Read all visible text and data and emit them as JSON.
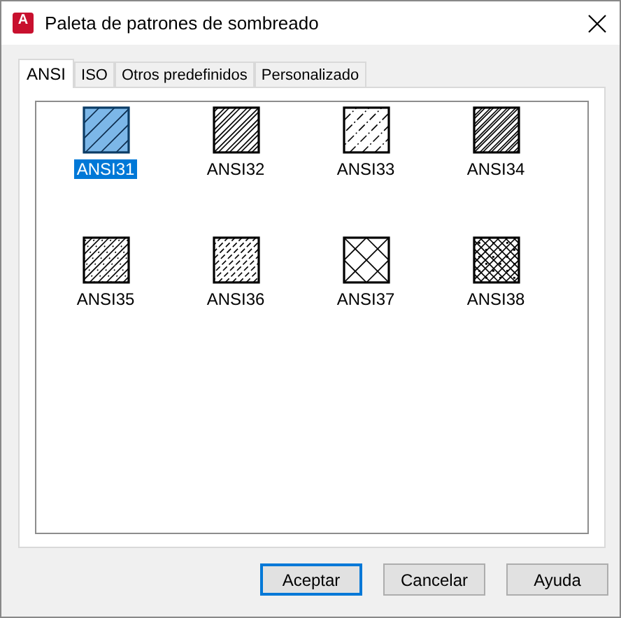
{
  "window": {
    "title": "Paleta de patrones de sombreado",
    "app_icon_letter": "A"
  },
  "tabs": [
    {
      "label": "ANSI",
      "selected": true
    },
    {
      "label": "ISO",
      "selected": false
    },
    {
      "label": "Otros predefinidos",
      "selected": false
    },
    {
      "label": "Personalizado",
      "selected": false
    }
  ],
  "patterns": [
    {
      "name": "ANSI31",
      "kind": "lines",
      "selected": true
    },
    {
      "name": "ANSI32",
      "kind": "pairs",
      "selected": false
    },
    {
      "name": "ANSI33",
      "kind": "dashed",
      "selected": false
    },
    {
      "name": "ANSI34",
      "kind": "dense",
      "selected": false
    },
    {
      "name": "ANSI35",
      "kind": "dotted",
      "selected": false
    },
    {
      "name": "ANSI36",
      "kind": "broken",
      "selected": false
    },
    {
      "name": "ANSI37",
      "kind": "cross",
      "selected": false
    },
    {
      "name": "ANSI38",
      "kind": "crossdot",
      "selected": false
    }
  ],
  "buttons": [
    {
      "label": "Aceptar",
      "default": true
    },
    {
      "label": "Cancelar",
      "default": false
    },
    {
      "label": "Ayuda",
      "default": false
    }
  ]
}
